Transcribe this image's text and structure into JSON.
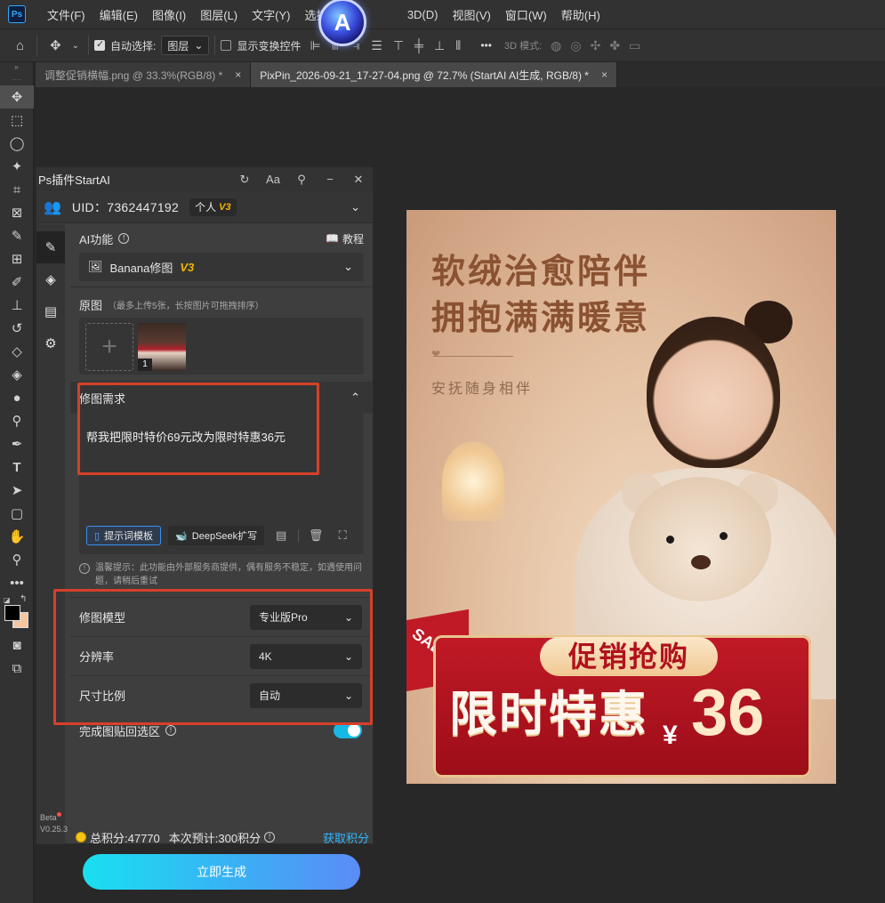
{
  "app": {
    "logo": "Ps",
    "menu": [
      "文件(F)",
      "编辑(E)",
      "图像(I)",
      "图层(L)",
      "文字(Y)",
      "选择(S)",
      "3D(D)",
      "视图(V)",
      "窗口(W)",
      "帮助(H)"
    ]
  },
  "options_bar": {
    "auto_select_label": "自动选择:",
    "auto_select_value": "图层",
    "show_transform_label": "显示变换控件",
    "more": "•••",
    "mode_3d_label": "3D 模式:"
  },
  "tabs": [
    {
      "label": "调整促销横幅.png @ 33.3%(RGB/8) *"
    },
    {
      "label": "PixPin_2026-09-21_17-27-04.png @ 72.7% (StartAI AI生成, RGB/8) *"
    }
  ],
  "plugin": {
    "title": "Ps插件StartAI",
    "uid": "UID：7362447192",
    "tier": "个人",
    "tier_version": "V3",
    "ai_function_label": "AI功能",
    "tutorial_label": "教程",
    "model_name": "Banana修图",
    "model_version": "V3",
    "original_label": "原图",
    "original_hint": "（最多上传5张，长按图片可拖拽排序）",
    "thumb_index": "1",
    "request_label": "修图需求",
    "request_text": "帮我把限时特价69元改为限时特惠36元",
    "prompt_template_label": "提示词模板",
    "deepseek_label": "DeepSeek扩写",
    "tip_text": "温馨提示：此功能由外部服务商提供，偶有服务不稳定，如遇使用问题，请稍后重试",
    "settings": [
      {
        "label": "修图模型",
        "value": "专业版Pro"
      },
      {
        "label": "分辨率",
        "value": "4K"
      },
      {
        "label": "尺寸比例",
        "value": "自动"
      }
    ],
    "paste_back_label": "完成图贴回选区",
    "paste_back_on": true,
    "total_points": "总积分:47770",
    "estimate_points": "本次预计:300积分",
    "get_points": "获取积分",
    "generate_label": "立即生成",
    "beta_label": "Beta",
    "version": "V0.25.3"
  },
  "canvas": {
    "headline_line1": "软绒治愈陪伴",
    "headline_line2": "拥抱满满暖意",
    "subline": "安抚随身相伴",
    "promo_title": "促销抢购",
    "promo_main": "限时特惠",
    "currency": "¥",
    "price": "36",
    "sale_tag": "SALE"
  },
  "colors": {
    "accent_blue": "#30b5ff",
    "highlight_red": "#d6402a",
    "version_gold": "#f5b400"
  }
}
